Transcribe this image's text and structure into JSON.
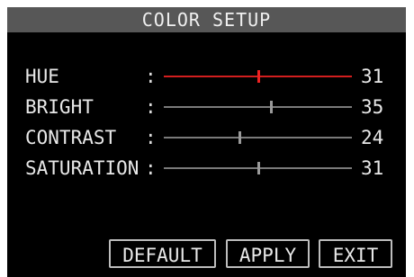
{
  "window": {
    "title": "COLOR SETUP"
  },
  "settings": [
    {
      "label": "HUE",
      "colon": ":",
      "value": "31",
      "slider_fraction": 0.5,
      "selected": true
    },
    {
      "label": "BRIGHT",
      "colon": ":",
      "value": "35",
      "slider_fraction": 0.57,
      "selected": false
    },
    {
      "label": "CONTRAST",
      "colon": ":",
      "value": "24",
      "slider_fraction": 0.4,
      "selected": false
    },
    {
      "label": "SATURATION",
      "colon": ":",
      "value": "31",
      "slider_fraction": 0.5,
      "selected": false
    }
  ],
  "buttons": {
    "default": "DEFAULT",
    "apply": "APPLY",
    "exit": "EXIT"
  },
  "colors": {
    "screen_background": "#000000",
    "title_background": "#575757",
    "text": "#e8e8e8",
    "track_normal": "#7a7a7a",
    "track_selected": "#d21e1e",
    "button_border": "#bdbdbd"
  }
}
